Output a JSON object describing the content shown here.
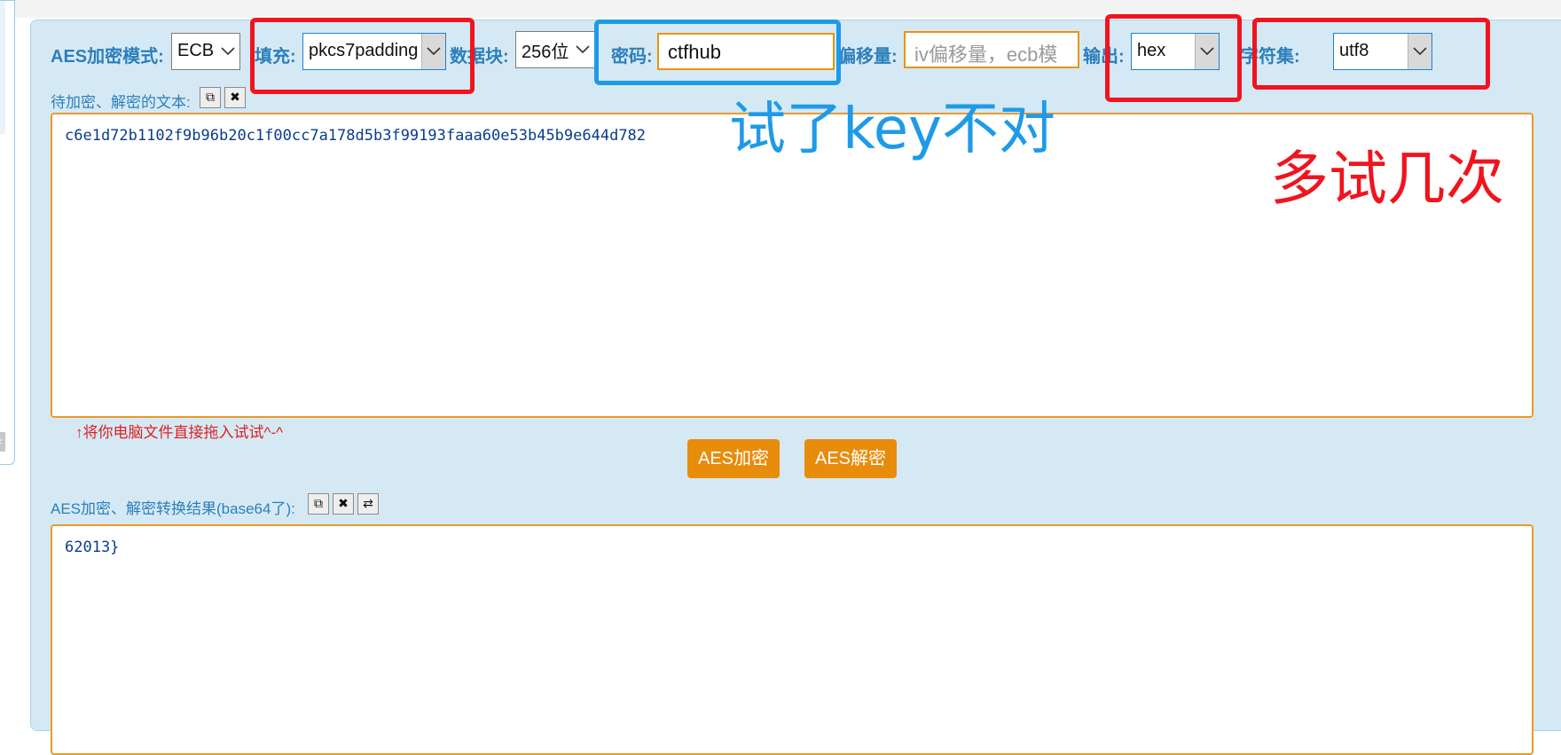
{
  "form": {
    "mode_label": "AES加密模式:",
    "mode_value": "ECB",
    "padding_label": "填充:",
    "padding_value": "pkcs7padding",
    "block_label": "数据块:",
    "block_value": "256位",
    "password_label": "密码:",
    "password_value": "ctfhub",
    "offset_label": "偏移量:",
    "offset_placeholder": "iv偏移量，ecb模",
    "output_label": "输出:",
    "output_value": "hex",
    "charset_label": "字符集:",
    "charset_value": "utf8"
  },
  "input_area": {
    "label": "待加密、解密的文本:",
    "text": "c6e1d72b1102f9b96b20c1f00cc7a178d5b3f99193faaa60e53b45b9e644d782",
    "hint": "↑将你电脑文件直接拖入试试^-^"
  },
  "buttons": {
    "encrypt": "AES加密",
    "decrypt": "AES解密"
  },
  "result_area": {
    "label": "AES加密、解密转换结果(base64了):",
    "text": "62013}"
  },
  "annotations": {
    "blue_note": "试了key不对",
    "red_note": "多试几次",
    "red_color": "#f0141e",
    "blue_color": "#1e9be8"
  },
  "icons": {
    "copy": "copy-icon",
    "clear": "close-icon",
    "swap": "swap-icon"
  }
}
